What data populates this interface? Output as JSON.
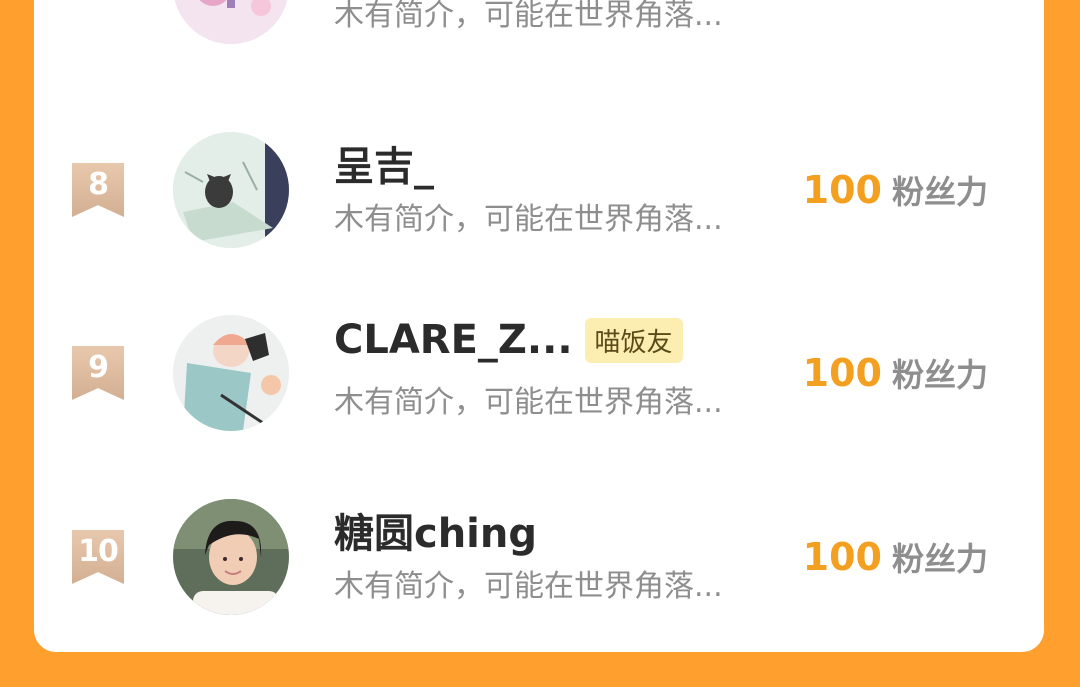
{
  "ranking": {
    "partial_top_row": {
      "bio": "木有简介，可能在世界角落..."
    },
    "rows": [
      {
        "rank": "8",
        "name": "呈吉_",
        "tag": "",
        "bio": "木有简介，可能在世界角落...",
        "score": "100",
        "score_unit": "粉丝力"
      },
      {
        "rank": "9",
        "name": "CLARE_Z...",
        "tag": "喵饭友",
        "bio": "木有简介，可能在世界角落...",
        "score": "100",
        "score_unit": "粉丝力"
      },
      {
        "rank": "10",
        "name": "糖圆ching",
        "tag": "",
        "bio": "木有简介，可能在世界角落...",
        "score": "100",
        "score_unit": "粉丝力"
      }
    ]
  },
  "colors": {
    "page_background": "#FF9F2E",
    "card_background": "#FFFFFF",
    "score_accent": "#F3A021",
    "rank_ribbon": "#D3AF92",
    "tag_background": "#FCEEB0"
  },
  "icons": {
    "rank_badge": "ribbon-bookmark-icon"
  }
}
